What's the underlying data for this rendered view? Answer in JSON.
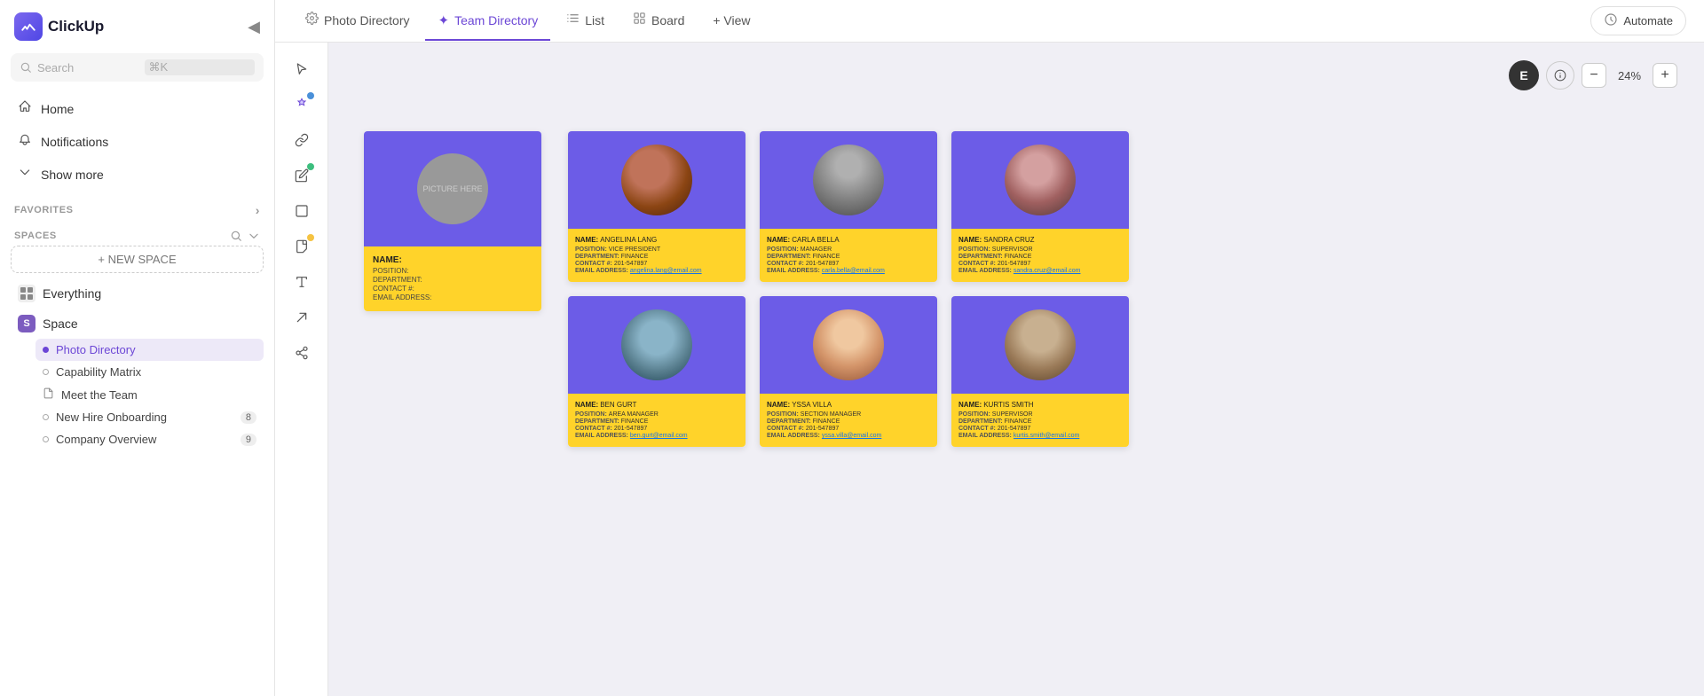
{
  "app": {
    "name": "ClickUp"
  },
  "sidebar": {
    "collapse_label": "◀",
    "search": {
      "placeholder": "Search",
      "shortcut": "⌘K"
    },
    "nav": [
      {
        "id": "home",
        "label": "Home",
        "icon": "🏠"
      },
      {
        "id": "notifications",
        "label": "Notifications",
        "icon": "🔔"
      },
      {
        "id": "show-more",
        "label": "Show more",
        "icon": "↓"
      }
    ],
    "favorites_label": "FAVORITES",
    "spaces_label": "SPACES",
    "new_space_label": "+ NEW SPACE",
    "everything_label": "Everything",
    "space_label": "Space",
    "items": [
      {
        "id": "photo-directory",
        "label": "Photo Directory",
        "active": true
      },
      {
        "id": "capability-matrix",
        "label": "Capability Matrix",
        "active": false
      },
      {
        "id": "meet-the-team",
        "label": "Meet the Team",
        "icon": "📄",
        "active": false
      },
      {
        "id": "new-hire-onboarding",
        "label": "New Hire Onboarding",
        "badge": "8",
        "active": false
      },
      {
        "id": "company-overview",
        "label": "Company Overview",
        "badge": "9",
        "active": false
      }
    ]
  },
  "tabs": [
    {
      "id": "photo-directory",
      "label": "Photo Directory",
      "icon": "⚙",
      "active": false
    },
    {
      "id": "team-directory",
      "label": "Team Directory",
      "icon": "✦",
      "active": true
    },
    {
      "id": "list",
      "label": "List",
      "icon": "≡",
      "active": false
    },
    {
      "id": "board",
      "label": "Board",
      "icon": "⊞",
      "active": false
    },
    {
      "id": "view",
      "label": "+ View",
      "active": false
    }
  ],
  "automate": {
    "label": "Automate"
  },
  "zoom": {
    "user_initial": "E",
    "level": "24%",
    "minus": "−",
    "plus": "+"
  },
  "template": {
    "picture_text": "PICTURE HERE",
    "name_label": "NAME:",
    "position_label": "POSITION:",
    "department_label": "DEPARTMENT:",
    "contact_label": "CONTACT #:",
    "email_label": "EMAIL ADDRESS:"
  },
  "people": [
    {
      "name": "Angelina Lang",
      "position": "Vice President",
      "department": "Finance",
      "contact": "201-547897",
      "email": "angelina.lang@email.com",
      "photo_class": "photo-1"
    },
    {
      "name": "Carla Bella",
      "position": "Manager",
      "department": "Finance",
      "contact": "201-547897",
      "email": "carla.bella@email.com",
      "photo_class": "photo-2"
    },
    {
      "name": "Sandra Cruz",
      "position": "Supervisor",
      "department": "Finance",
      "contact": "201-547897",
      "email": "sandra.cruz@email.com",
      "photo_class": "photo-3"
    },
    {
      "name": "Ben Gurt",
      "position": "Area Manager",
      "department": "Finance",
      "contact": "201-547897",
      "email": "ben.gurt@email.com",
      "photo_class": "photo-4"
    },
    {
      "name": "Yssa Villa",
      "position": "Section Manager",
      "department": "Finance",
      "contact": "201-547897",
      "email": "yssa.villa@email.com",
      "photo_class": "photo-5"
    },
    {
      "name": "Kurtis Smith",
      "position": "Supervisor",
      "department": "Finance",
      "contact": "201-547897",
      "email": "kurtis.smith@email.com",
      "photo_class": "photo-6"
    }
  ],
  "tools": [
    {
      "id": "cursor",
      "icon": "▷",
      "dot": null
    },
    {
      "id": "add-icon",
      "icon": "✦+",
      "dot": "blue"
    },
    {
      "id": "link",
      "icon": "🔗",
      "dot": null
    },
    {
      "id": "pencil",
      "icon": "✏",
      "dot": "green"
    },
    {
      "id": "rect",
      "icon": "□",
      "dot": null
    },
    {
      "id": "note",
      "icon": "🗒",
      "dot": "yellow"
    },
    {
      "id": "text",
      "icon": "T",
      "dot": null
    },
    {
      "id": "arrow",
      "icon": "↗",
      "dot": null
    },
    {
      "id": "share",
      "icon": "⚬⚬⚬",
      "dot": null
    }
  ]
}
